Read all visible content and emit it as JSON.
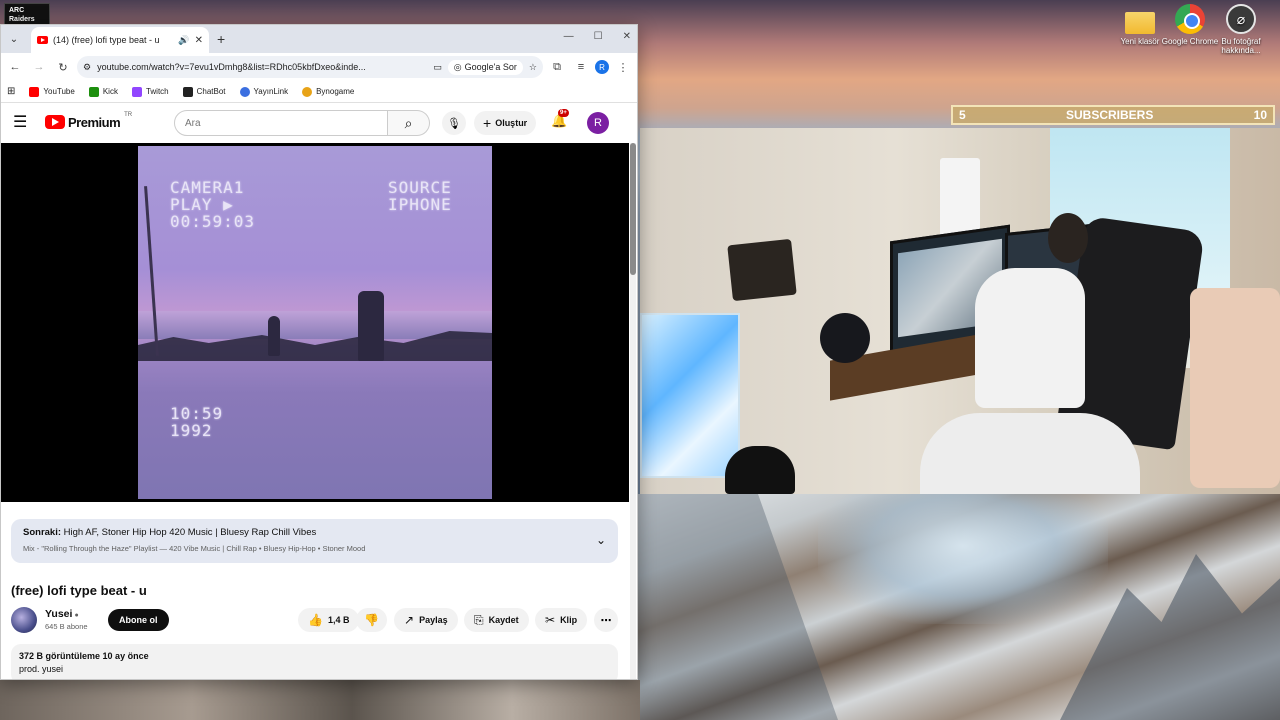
{
  "desktop": {
    "corner_logo": "ARC Raiders",
    "icons": [
      {
        "label": "Yeni klasör",
        "icon": "folder-icon"
      },
      {
        "label": "Google Chrome",
        "icon": "chrome-icon"
      },
      {
        "label": "Bu fotoğraf hakkında...",
        "icon": "camera-icon"
      }
    ]
  },
  "overlay": {
    "sub_left": "5",
    "sub_label": "SUBSCRIBERS",
    "sub_right": "10"
  },
  "browser": {
    "tab_title": "(14) (free) lofi type beat - u",
    "url": "youtube.com/watch?v=7evu1vDmhg8&list=RDhc05kbfDxeo&inde...",
    "google_sor": "Google'a Sor",
    "profile_initial": "R",
    "bookmarks": [
      {
        "label": "YouTube",
        "color": "#ff0000"
      },
      {
        "label": "Kick",
        "color": "#53fc18"
      },
      {
        "label": "Twitch",
        "color": "#9146ff"
      },
      {
        "label": "ChatBot",
        "color": "#222222"
      },
      {
        "label": "YayınLink",
        "color": "#3b6fe0"
      },
      {
        "label": "Bynogame",
        "color": "#e8a317"
      }
    ]
  },
  "youtube": {
    "logo_word": "Premium",
    "logo_region": "TR",
    "search_placeholder": "Ara",
    "create_label": "Oluştur",
    "notif_badge": "9+",
    "avatar_initial": "R",
    "video_osd": {
      "camera": "CAMERA1",
      "play": "PLAY ▶",
      "time": "00:59:03",
      "source": "SOURCE",
      "device": "IPHONE",
      "clock": "10:59",
      "year": "1992"
    },
    "up_next": {
      "prefix": "Sonraki:",
      "title": "High AF, Stoner Hip Hop 420 Music | Bluesy Rap Chill Vibes",
      "subtitle": "Mix - \"Rolling Through the Haze\" Playlist — 420 Vibe Music | Chill Rap • Bluesy Hip-Hop • Stoner Mood"
    },
    "video_title": "(free) lofi type beat - u",
    "channel": {
      "name": "Yusei",
      "subs": "645 B abone",
      "subscribe_label": "Abone ol"
    },
    "actions": {
      "likes": "1,4 B",
      "share": "Paylaş",
      "save": "Kaydet",
      "clip": "Klip"
    },
    "description": {
      "views": "372 B görüntüleme",
      "age": "10 ay önce",
      "text": "prod. yusei"
    }
  }
}
